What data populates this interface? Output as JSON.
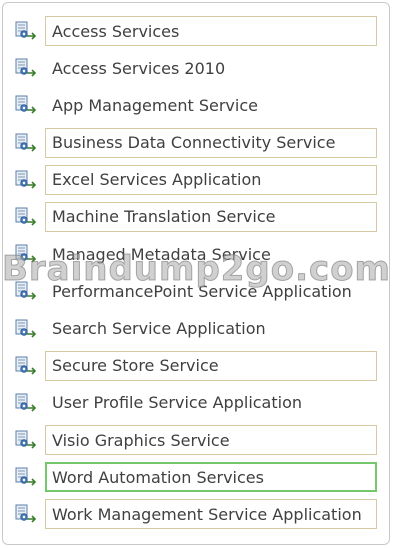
{
  "services": [
    {
      "label": "Access Services",
      "boxed": true,
      "selected": false
    },
    {
      "label": "Access Services 2010",
      "boxed": false,
      "selected": false
    },
    {
      "label": "App Management Service",
      "boxed": false,
      "selected": false
    },
    {
      "label": "Business Data Connectivity Service",
      "boxed": true,
      "selected": false
    },
    {
      "label": "Excel Services Application",
      "boxed": true,
      "selected": false
    },
    {
      "label": "Machine Translation Service",
      "boxed": true,
      "selected": false
    },
    {
      "label": "Managed Metadata Service",
      "boxed": false,
      "selected": false
    },
    {
      "label": "PerformancePoint Service Application",
      "boxed": false,
      "selected": false
    },
    {
      "label": "Search Service Application",
      "boxed": false,
      "selected": false
    },
    {
      "label": "Secure Store Service",
      "boxed": true,
      "selected": false
    },
    {
      "label": "User Profile Service Application",
      "boxed": false,
      "selected": false
    },
    {
      "label": "Visio Graphics Service",
      "boxed": true,
      "selected": false
    },
    {
      "label": "Word Automation Services",
      "boxed": false,
      "selected": true
    },
    {
      "label": "Work Management Service Application",
      "boxed": true,
      "selected": false
    }
  ],
  "icon_name": "service-application-icon",
  "colors": {
    "box_border": "#d6c9a4",
    "selected_border": "#74c76b",
    "text": "#404040"
  },
  "watermark": {
    "text": "Braindump2go.com"
  }
}
